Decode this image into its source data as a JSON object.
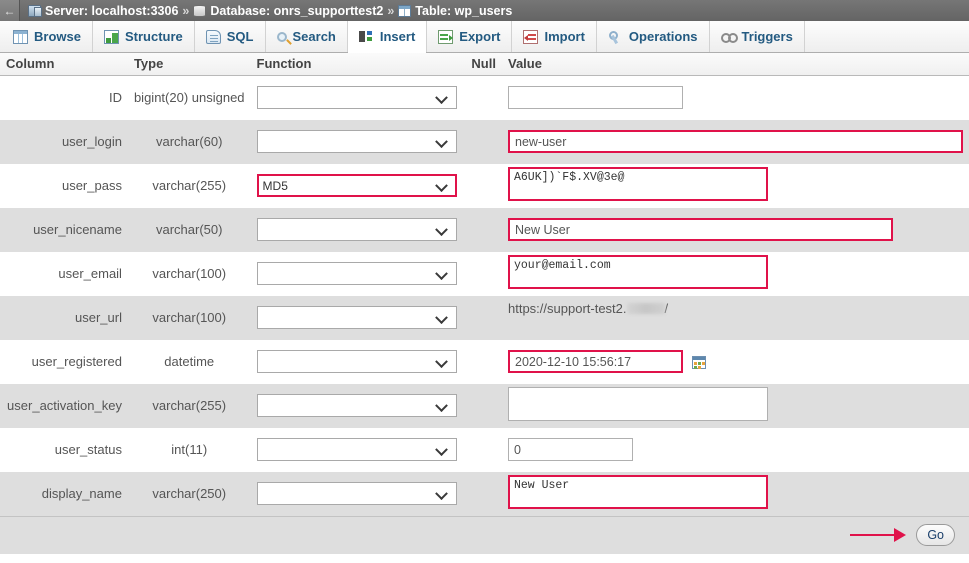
{
  "breadcrumb": {
    "back_label": "←",
    "server": "Server: localhost:3306",
    "separator": "»",
    "database": "Database: onrs_supporttest2",
    "table": "Table: wp_users"
  },
  "tabs": [
    {
      "label": "Browse",
      "icon": "browse-icon",
      "active": false
    },
    {
      "label": "Structure",
      "icon": "structure-icon",
      "active": false
    },
    {
      "label": "SQL",
      "icon": "sql-icon",
      "active": false
    },
    {
      "label": "Search",
      "icon": "search-icon",
      "active": false
    },
    {
      "label": "Insert",
      "icon": "insert-icon",
      "active": true
    },
    {
      "label": "Export",
      "icon": "export-icon",
      "active": false
    },
    {
      "label": "Import",
      "icon": "import-icon",
      "active": false
    },
    {
      "label": "Operations",
      "icon": "operations-icon",
      "active": false
    },
    {
      "label": "Triggers",
      "icon": "triggers-icon",
      "active": false
    }
  ],
  "table_headers": {
    "column": "Column",
    "type": "Type",
    "function": "Function",
    "null": "Null",
    "value": "Value"
  },
  "rows": [
    {
      "column": "ID",
      "type": "bigint(20) unsigned",
      "function": "",
      "value": "",
      "field": "input",
      "highlight_value": false,
      "highlight_function": false
    },
    {
      "column": "user_login",
      "type": "varchar(60)",
      "function": "",
      "value": "new-user",
      "field": "input",
      "highlight_value": true,
      "highlight_function": false
    },
    {
      "column": "user_pass",
      "type": "varchar(255)",
      "function": "MD5",
      "value": "A6UK])`F$.XV@3e@",
      "field": "textarea",
      "highlight_value": true,
      "highlight_function": true
    },
    {
      "column": "user_nicename",
      "type": "varchar(50)",
      "function": "",
      "value": "New User",
      "field": "input",
      "highlight_value": true,
      "highlight_function": false
    },
    {
      "column": "user_email",
      "type": "varchar(100)",
      "function": "",
      "value": "your@email.com",
      "field": "textarea",
      "highlight_value": true,
      "highlight_function": false
    },
    {
      "column": "user_url",
      "type": "varchar(100)",
      "function": "",
      "value": "https://support-test2.",
      "value_suffix": "/",
      "value_redacted": true,
      "field": "textarea",
      "highlight_value": true,
      "highlight_function": false
    },
    {
      "column": "user_registered",
      "type": "datetime",
      "function": "",
      "value": "2020-12-10 15:56:17",
      "field": "input",
      "has_calendar": true,
      "highlight_value": true,
      "highlight_function": false
    },
    {
      "column": "user_activation_key",
      "type": "varchar(255)",
      "function": "",
      "value": "",
      "field": "textarea",
      "highlight_value": false,
      "highlight_function": false
    },
    {
      "column": "user_status",
      "type": "int(11)",
      "function": "",
      "value": "0",
      "field": "input",
      "highlight_value": false,
      "highlight_function": false
    },
    {
      "column": "display_name",
      "type": "varchar(250)",
      "function": "",
      "value": "New User",
      "field": "textarea",
      "highlight_value": true,
      "highlight_function": false
    }
  ],
  "footer": {
    "go_label": "Go",
    "arrow": "→"
  },
  "colors": {
    "highlight": "#e0124a",
    "breadcrumb_bg": "#6b6b6b",
    "tab_text": "#235a81",
    "row_alt_bg": "#dedede"
  }
}
